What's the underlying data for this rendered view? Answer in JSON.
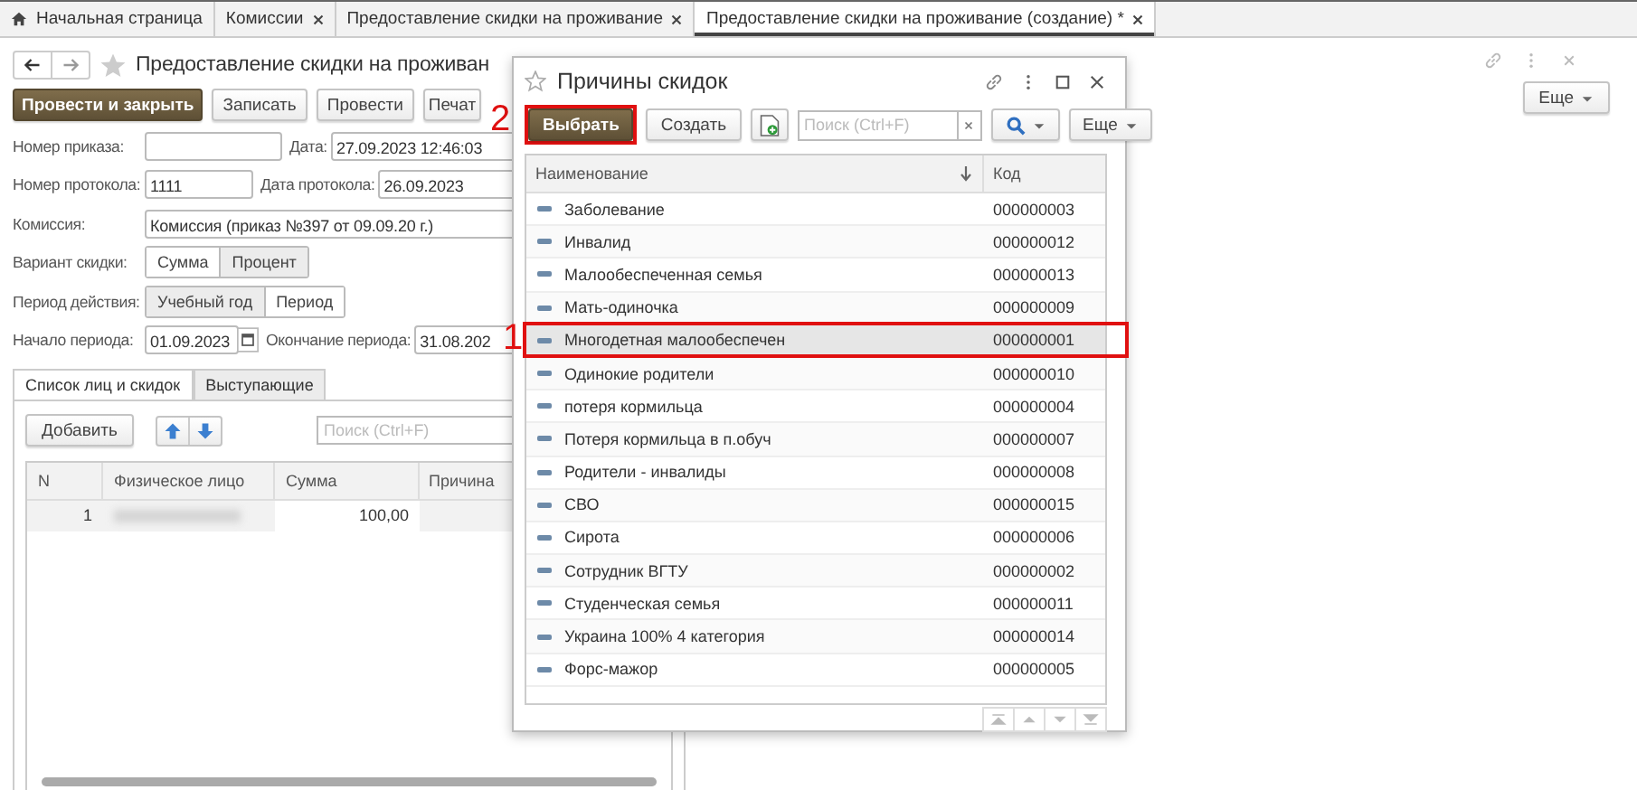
{
  "tabs": [
    {
      "label": "Начальная страница",
      "kind": "home",
      "closable": false,
      "selected": false
    },
    {
      "label": "Комиссии",
      "kind": "doc",
      "closable": true,
      "selected": false
    },
    {
      "label": "Предоставление скидки на проживание",
      "kind": "doc",
      "closable": true,
      "selected": false
    },
    {
      "label": "Предоставление скидки на проживание (создание) *",
      "kind": "doc",
      "closable": true,
      "selected": true
    }
  ],
  "form": {
    "title": "Предоставление скидки на проживан",
    "more": "Еще",
    "actions": [
      {
        "label": "Провести и закрыть",
        "primary": true
      },
      {
        "label": "Записать",
        "primary": false
      },
      {
        "label": "Провести",
        "primary": false
      },
      {
        "label": "Печат",
        "primary": false
      }
    ],
    "order_number": {
      "label": "Номер приказа:"
    },
    "date": {
      "label": "Дата:",
      "value": "27.09.2023 12:46:03"
    },
    "protocol_number": {
      "label": "Номер протокола:",
      "value": "1111"
    },
    "protocol_date": {
      "label": "Дата протокола:",
      "value": "26.09.2023"
    },
    "commission": {
      "label": "Комиссия:",
      "value": "Комиссия (приказ №397 от 09.09.20 г.)"
    },
    "discount_variant": {
      "label": "Вариант скидки:",
      "options": [
        {
          "label": "Сумма",
          "selected": false
        },
        {
          "label": "Процент",
          "selected": true
        }
      ]
    },
    "period_type": {
      "label": "Период действия:",
      "options": [
        {
          "label": "Учебный год",
          "selected": true
        },
        {
          "label": "Период",
          "selected": false
        }
      ]
    },
    "period_start": {
      "label": "Начало периода:",
      "value": "01.09.2023"
    },
    "period_end": {
      "label": "Окончание периода:",
      "value": "31.08.202"
    },
    "subtabs": [
      {
        "label": "Список лиц и скидок",
        "selected": true
      },
      {
        "label": "Выступающие",
        "selected": false
      }
    ],
    "add_button": "Добавить",
    "search_placeholder": "Поиск (Ctrl+F)",
    "table": {
      "columns": [
        "N",
        "Физическое лицо",
        "Сумма",
        "Причина"
      ],
      "rows": [
        {
          "n": "1",
          "person_redacted": true,
          "sum": "100,00"
        }
      ]
    }
  },
  "dialog": {
    "title": "Причины скидок",
    "select_button": {
      "label": "Выбрать",
      "annotation": "2"
    },
    "create_button": "Создать",
    "search_placeholder": "Поиск (Ctrl+F)",
    "more": "Еще",
    "columns": [
      "Наименование",
      "Код"
    ],
    "rows": [
      {
        "name": "Заболевание",
        "code": "000000003",
        "selected": false
      },
      {
        "name": "Инвалид",
        "code": "000000012",
        "selected": false
      },
      {
        "name": "Малообеспеченная семья",
        "code": "000000013",
        "selected": false
      },
      {
        "name": "Мать-одиночка",
        "code": "000000009",
        "selected": false
      },
      {
        "name": "Многодетная малообеспечен",
        "code": "000000001",
        "selected": true,
        "annotation": "1"
      },
      {
        "name": "Одинокие родители",
        "code": "000000010",
        "selected": false
      },
      {
        "name": "потеря кормильца",
        "code": "000000004",
        "selected": false
      },
      {
        "name": "Потеря кормильца в п.обуч",
        "code": "000000007",
        "selected": false
      },
      {
        "name": "Родители - инвалиды",
        "code": "000000008",
        "selected": false
      },
      {
        "name": "СВО",
        "code": "000000015",
        "selected": false
      },
      {
        "name": "Сирота",
        "code": "000000006",
        "selected": false
      },
      {
        "name": "Сотрудник ВГТУ",
        "code": "000000002",
        "selected": false
      },
      {
        "name": "Студенческая семья",
        "code": "000000011",
        "selected": false
      },
      {
        "name": "Украина 100% 4 категория",
        "code": "000000014",
        "selected": false
      },
      {
        "name": "Форс-мажор",
        "code": "000000005",
        "selected": false
      }
    ]
  }
}
